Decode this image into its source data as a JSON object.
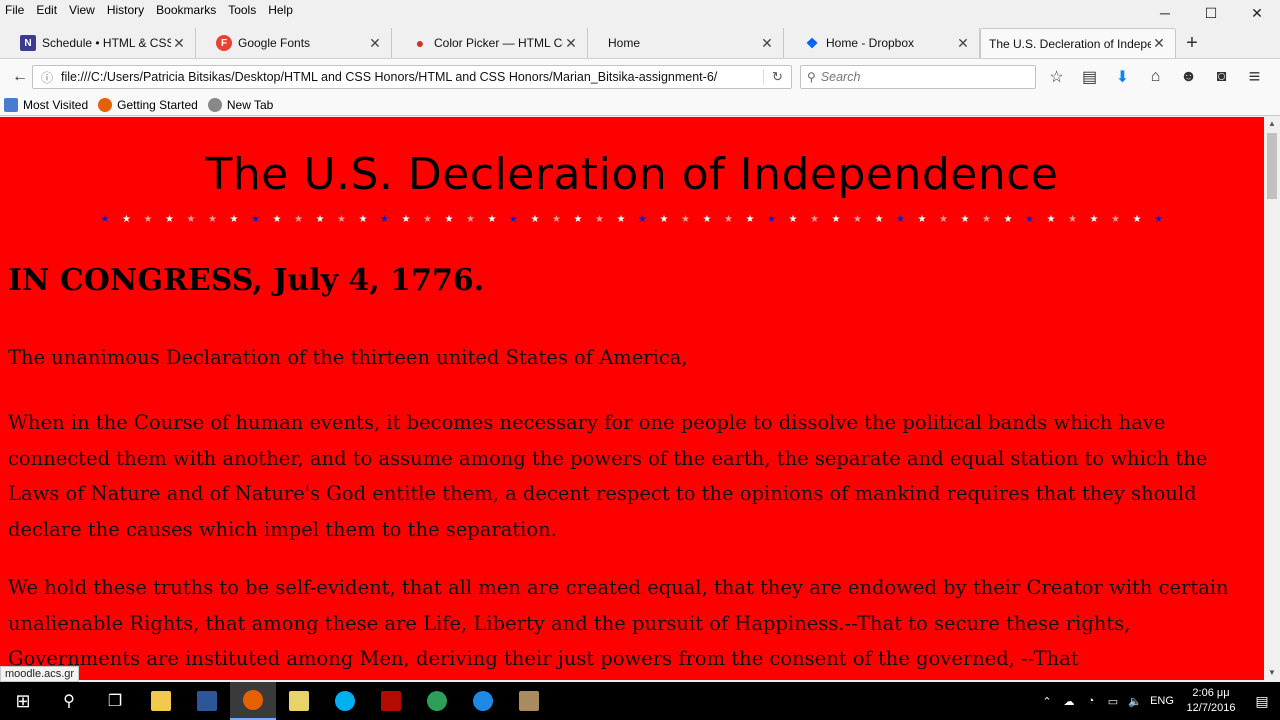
{
  "menu": [
    "File",
    "Edit",
    "View",
    "History",
    "Bookmarks",
    "Tools",
    "Help"
  ],
  "window_controls": {
    "minimize": "─",
    "maximize": "☐",
    "close": "✕"
  },
  "tabs": [
    {
      "title": "Schedule • HTML & CSS ...",
      "icon": "N",
      "icon_color": "#3b3b8f"
    },
    {
      "title": "Google Fonts",
      "icon": "F",
      "icon_color": "#e94235"
    },
    {
      "title": "Color Picker — HTML Col...",
      "icon": "●",
      "icon_color": "#d32f2f"
    },
    {
      "title": "Home",
      "icon": "",
      "icon_color": ""
    },
    {
      "title": "Home - Dropbox",
      "icon": "❖",
      "icon_color": "#0061fe"
    },
    {
      "title": "The U.S. Decleration of Indepe...",
      "icon": "",
      "icon_color": ""
    }
  ],
  "tab_close": "✕",
  "new_tab": "+",
  "nav": {
    "back": "←",
    "info": "ⓘ",
    "url": "file:///C:/Users/Patricia Bitsikas/Desktop/HTML and CSS Honors/HTML and CSS Honors/Marian_Bitsika-assignment-6/",
    "reload": "↻",
    "search_placeholder": "Search",
    "search_icon": "⚲"
  },
  "toolbar_icons": [
    "☆",
    "▤",
    "⬇",
    "⌂",
    "☻",
    "◙",
    "≡"
  ],
  "bookmarks": [
    {
      "label": "Most Visited",
      "color": "#4a7bd0"
    },
    {
      "label": "Getting Started",
      "color": "#e66000"
    },
    {
      "label": "New Tab",
      "color": "#888888"
    }
  ],
  "page": {
    "title": "The U.S. Decleration of Independence",
    "heading": "IN CONGRESS, July 4, 1776.",
    "paragraphs": [
      "The unanimous Declaration of the thirteen united States of America,",
      "When in the Course of human events, it becomes necessary for one people to dissolve the political bands which have connected them with another, and to assume among the powers of the earth, the separate and equal station to which the Laws of Nature and of Nature's God entitle them, a decent respect to the opinions of mankind requires that they should declare the causes which impel them to the separation.",
      "We hold these truths to be self-evident, that all men are created equal, that they are endowed by their Creator with certain unalienable Rights, that among these are Life, Liberty and the pursuit of Happiness.--That to secure these rights, Governments are instituted among Men, deriving their just powers from the consent of the governed, --That"
    ],
    "background": "#ff0000",
    "star_pattern": [
      "b",
      "w",
      "f",
      "w",
      "f",
      "f",
      "w",
      "b",
      "w",
      "f",
      "w",
      "f",
      "w",
      "b",
      "w",
      "f",
      "w",
      "f",
      "w",
      "b",
      "w",
      "f",
      "w",
      "f",
      "w",
      "b",
      "w",
      "f",
      "w",
      "f",
      "w",
      "b",
      "w",
      "f",
      "w",
      "f",
      "w",
      "b",
      "w",
      "f",
      "w",
      "f",
      "w",
      "b",
      "w",
      "f",
      "w",
      "f",
      "w",
      "b"
    ]
  },
  "status_link": "moodle.acs.gr",
  "scroll": {
    "up": "▲",
    "down": "▼"
  },
  "taskbar": {
    "start": "⊞",
    "search": "⚲",
    "task_view": "❐",
    "apps": [
      {
        "name": "file-explorer",
        "color": "#f2c94c"
      },
      {
        "name": "word",
        "color": "#2b579a"
      },
      {
        "name": "firefox",
        "color": "#e66000",
        "active": true
      },
      {
        "name": "folder",
        "color": "#e8d26a"
      },
      {
        "name": "skype",
        "color": "#00aff0"
      },
      {
        "name": "acrobat",
        "color": "#b30b00"
      },
      {
        "name": "app-green",
        "color": "#2e9e5a"
      },
      {
        "name": "edge",
        "color": "#1e88e5"
      },
      {
        "name": "app-box",
        "color": "#a98b5f"
      }
    ],
    "tray_icons": [
      "⌃",
      "☁",
      "◔",
      "▭",
      "🔈"
    ],
    "language": "ENG",
    "time": "2:06 μμ",
    "date": "12/7/2016",
    "notifications": "▤"
  }
}
